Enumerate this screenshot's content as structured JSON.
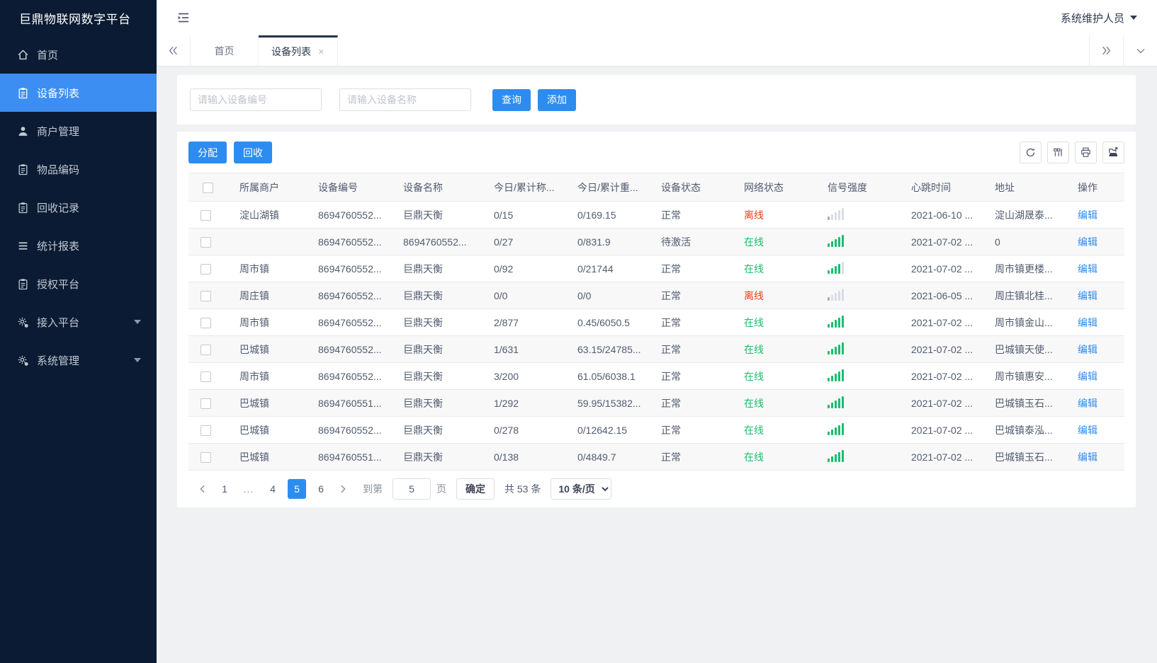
{
  "app": {
    "title": "巨鼎物联网数字平台",
    "user_name": "系统维护人员"
  },
  "sidebar": {
    "items": [
      {
        "key": "home",
        "label": "首页",
        "icon": "home",
        "active": false,
        "expandable": false
      },
      {
        "key": "device-list",
        "label": "设备列表",
        "icon": "clipboard",
        "active": true,
        "expandable": false
      },
      {
        "key": "merchant-manage",
        "label": "商户管理",
        "icon": "user",
        "active": false,
        "expandable": false
      },
      {
        "key": "item-code",
        "label": "物品编码",
        "icon": "clipboard",
        "active": false,
        "expandable": false
      },
      {
        "key": "recycle-record",
        "label": "回收记录",
        "icon": "clipboard",
        "active": false,
        "expandable": false
      },
      {
        "key": "stats-report",
        "label": "统计报表",
        "icon": "rows",
        "active": false,
        "expandable": false
      },
      {
        "key": "auth-platform",
        "label": "授权平台",
        "icon": "clipboard",
        "active": false,
        "expandable": false
      },
      {
        "key": "access-platform",
        "label": "接入平台",
        "icon": "gear",
        "active": false,
        "expandable": true
      },
      {
        "key": "system-manage",
        "label": "系统管理",
        "icon": "gear",
        "active": false,
        "expandable": true
      }
    ]
  },
  "tabs": {
    "items": [
      {
        "label": "首页",
        "active": false,
        "closable": false
      },
      {
        "label": "设备列表",
        "active": true,
        "closable": true
      }
    ]
  },
  "search": {
    "device_no_placeholder": "请输入设备编号",
    "device_name_placeholder": "请输入设备名称",
    "query_label": "查询",
    "add_label": "添加"
  },
  "toolbar": {
    "assign_label": "分配",
    "recycle_label": "回收",
    "icons": [
      "refresh-icon",
      "columns-icon",
      "print-icon",
      "export-icon"
    ]
  },
  "table": {
    "columns": [
      "所属商户",
      "设备编号",
      "设备名称",
      "今日/累计称...",
      "今日/累计重...",
      "设备状态",
      "网络状态",
      "信号强度",
      "心跳时间",
      "地址",
      "操作"
    ],
    "rows": [
      {
        "merchant": "淀山湖镇",
        "device_no": "8694760552...",
        "device_name": "巨鼎天衡",
        "today_count": "0/15",
        "today_weight": "0/169.15",
        "device_status": "正常",
        "network_status": "离线",
        "online": false,
        "signal": 1,
        "heartbeat": "2021-06-10 ...",
        "address": "淀山湖晟泰...",
        "action": "编辑"
      },
      {
        "merchant": "",
        "device_no": "8694760552...",
        "device_name": "8694760552...",
        "today_count": "0/27",
        "today_weight": "0/831.9",
        "device_status": "待激活",
        "network_status": "在线",
        "online": true,
        "signal": 5,
        "heartbeat": "2021-07-02 ...",
        "address": "0",
        "action": "编辑"
      },
      {
        "merchant": "周市镇",
        "device_no": "8694760552...",
        "device_name": "巨鼎天衡",
        "today_count": "0/92",
        "today_weight": "0/21744",
        "device_status": "正常",
        "network_status": "在线",
        "online": true,
        "signal": 4,
        "heartbeat": "2021-07-02 ...",
        "address": "周市镇更楼...",
        "action": "编辑"
      },
      {
        "merchant": "周庄镇",
        "device_no": "8694760552...",
        "device_name": "巨鼎天衡",
        "today_count": "0/0",
        "today_weight": "0/0",
        "device_status": "正常",
        "network_status": "离线",
        "online": false,
        "signal": 1,
        "heartbeat": "2021-06-05 ...",
        "address": "周庄镇北桂...",
        "action": "编辑"
      },
      {
        "merchant": "周市镇",
        "device_no": "8694760552...",
        "device_name": "巨鼎天衡",
        "today_count": "2/877",
        "today_weight": "0.45/6050.5",
        "device_status": "正常",
        "network_status": "在线",
        "online": true,
        "signal": 5,
        "heartbeat": "2021-07-02 ...",
        "address": "周市镇金山...",
        "action": "编辑"
      },
      {
        "merchant": "巴城镇",
        "device_no": "8694760552...",
        "device_name": "巨鼎天衡",
        "today_count": "1/631",
        "today_weight": "63.15/24785...",
        "device_status": "正常",
        "network_status": "在线",
        "online": true,
        "signal": 5,
        "heartbeat": "2021-07-02 ...",
        "address": "巴城镇天使...",
        "action": "编辑"
      },
      {
        "merchant": "周市镇",
        "device_no": "8694760552...",
        "device_name": "巨鼎天衡",
        "today_count": "3/200",
        "today_weight": "61.05/6038.1",
        "device_status": "正常",
        "network_status": "在线",
        "online": true,
        "signal": 5,
        "heartbeat": "2021-07-02 ...",
        "address": "周市镇惠安...",
        "action": "编辑"
      },
      {
        "merchant": "巴城镇",
        "device_no": "8694760551...",
        "device_name": "巨鼎天衡",
        "today_count": "1/292",
        "today_weight": "59.95/15382...",
        "device_status": "正常",
        "network_status": "在线",
        "online": true,
        "signal": 5,
        "heartbeat": "2021-07-02 ...",
        "address": "巴城镇玉石...",
        "action": "编辑"
      },
      {
        "merchant": "巴城镇",
        "device_no": "8694760552...",
        "device_name": "巨鼎天衡",
        "today_count": "0/278",
        "today_weight": "0/12642.15",
        "device_status": "正常",
        "network_status": "在线",
        "online": true,
        "signal": 5,
        "heartbeat": "2021-07-02 ...",
        "address": "巴城镇泰泓...",
        "action": "编辑"
      },
      {
        "merchant": "巴城镇",
        "device_no": "8694760551...",
        "device_name": "巨鼎天衡",
        "today_count": "0/138",
        "today_weight": "0/4849.7",
        "device_status": "正常",
        "network_status": "在线",
        "online": true,
        "signal": 5,
        "heartbeat": "2021-07-02 ...",
        "address": "巴城镇玉石...",
        "action": "编辑"
      }
    ]
  },
  "pagination": {
    "pages": [
      "1",
      "...",
      "4",
      "5",
      "6"
    ],
    "active_page": "5",
    "goto_prefix": "到第",
    "goto_value": "5",
    "goto_suffix": "页",
    "confirm_label": "确定",
    "total_label": "共 53 条",
    "page_size_label": "10 条/页"
  },
  "colors": {
    "accent": "#2d8cf0",
    "sidebar_bg": "#0a1b33",
    "sidebar_active": "#3d8ef2",
    "online": "#19be6b",
    "offline": "#ed4014",
    "signal_inactive": "#d7dde4",
    "signal_offline": "#a6adb8"
  }
}
